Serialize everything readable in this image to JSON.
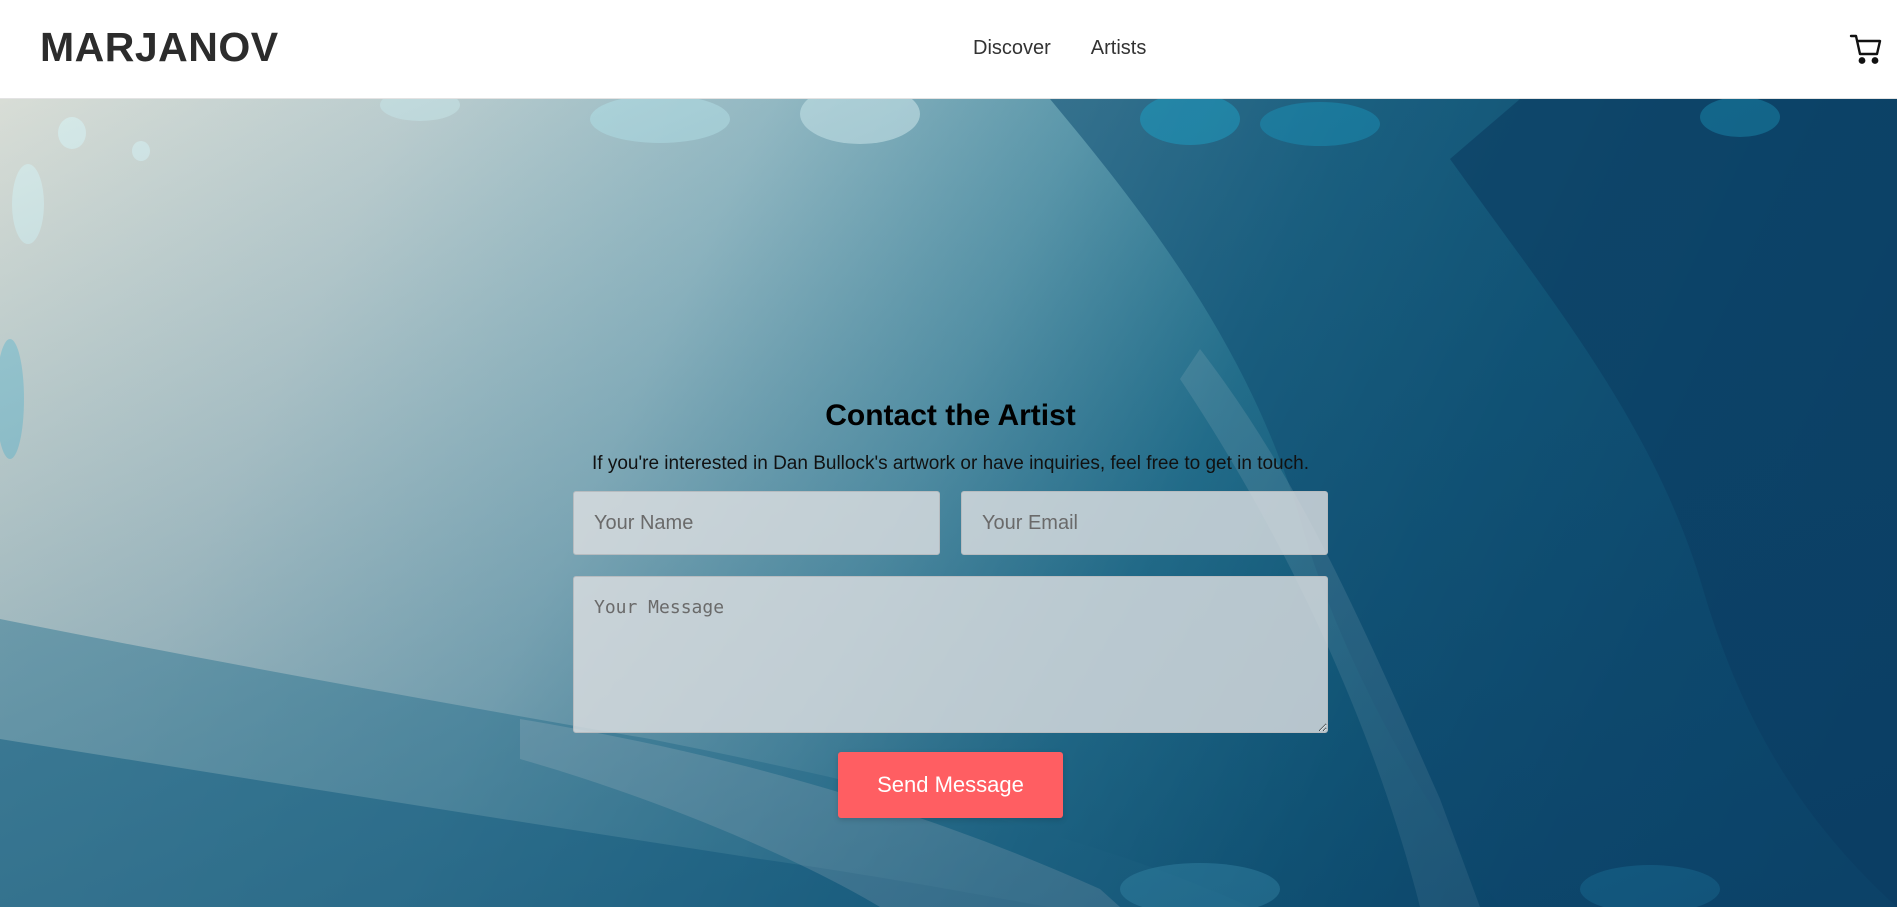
{
  "header": {
    "logo": "MARJANOV",
    "nav": [
      {
        "label": "Discover"
      },
      {
        "label": "Artists"
      }
    ],
    "cart_icon": "cart-icon"
  },
  "contact": {
    "title": "Contact the Artist",
    "description": "If you're interested in Dan Bullock's artwork or have inquiries, feel free to get in touch.",
    "name_placeholder": "Your Name",
    "email_placeholder": "Your Email",
    "message_placeholder": "Your Message",
    "send_label": "Send Message"
  },
  "colors": {
    "accent": "#ff5e62",
    "logo": "#2c2c2c",
    "header_bg": "#ffffff"
  }
}
